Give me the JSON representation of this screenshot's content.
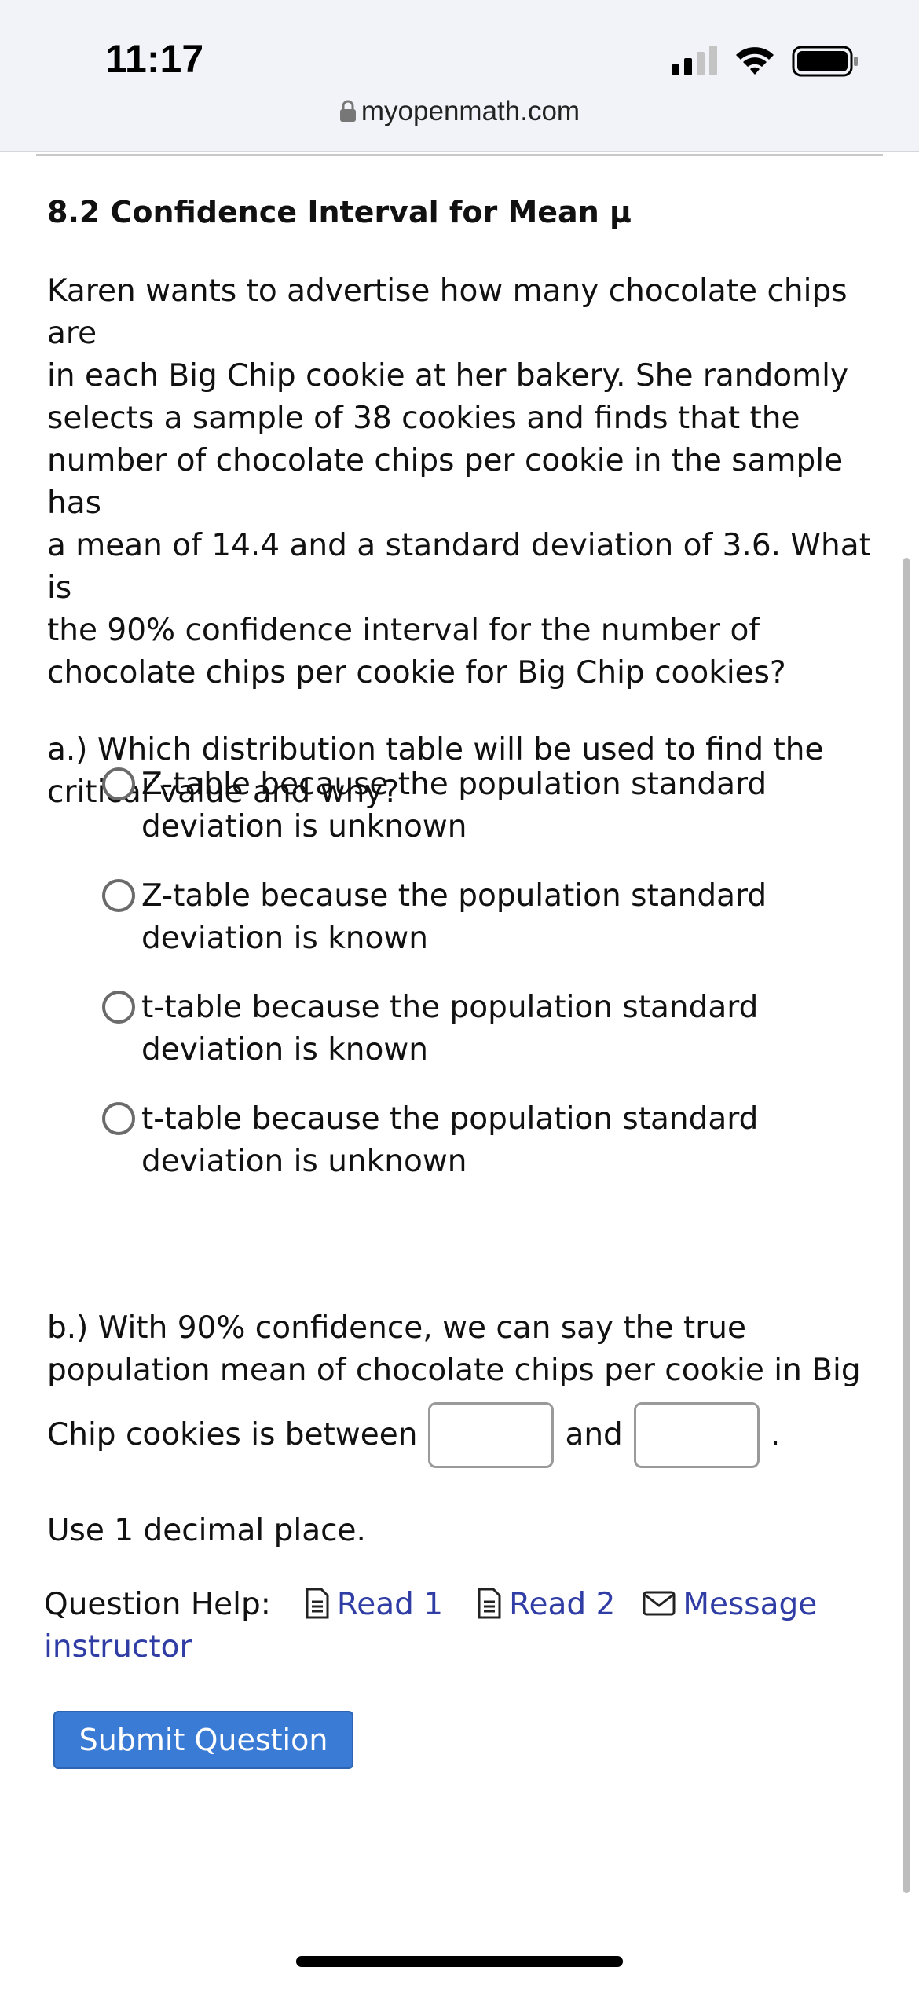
{
  "status_bar": {
    "time": "11:17"
  },
  "browser": {
    "url": "myopenmath.com"
  },
  "question": {
    "title": "8.2 Confidence Interval for Mean μ",
    "problem_lines": [
      "Karen wants to advertise how many chocolate chips are",
      "in each Big Chip cookie at her bakery. She randomly",
      "selects a sample of 38 cookies and finds that the",
      "number of chocolate chips per cookie in the sample has",
      "a mean of 14.4 and a standard deviation of 3.6. What is",
      "the 90% confidence interval for the number of",
      "chocolate chips per cookie for Big Chip cookies?"
    ],
    "part_a_lines": [
      "a.) Which distribution table will be used to find the",
      "critical value and why?"
    ],
    "options": [
      {
        "line1": "Z-table because the population standard",
        "line2": "deviation is unknown"
      },
      {
        "line1": "Z-table because the population standard",
        "line2": "deviation is known"
      },
      {
        "line1": "t-table because the population standard",
        "line2": "deviation is known"
      },
      {
        "line1": "t-table because the population standard",
        "line2": "deviation is unknown"
      }
    ],
    "part_b_line1": "b.) With 90% confidence, we can say the true",
    "part_b_line2": "population mean of chocolate chips per cookie in Big",
    "part_b_line3_prefix": "Chip cookies is between",
    "part_b_and": "and",
    "part_b_period": ".",
    "decimals_note": "Use 1 decimal place."
  },
  "help": {
    "label": "Question Help:",
    "read1": "Read 1",
    "read2": "Read 2",
    "message_part1": "Message",
    "message_part2": "instructor"
  },
  "submit_label": "Submit Question",
  "colors": {
    "link": "#2f3da4",
    "submit_bg": "#3a7bd5"
  }
}
